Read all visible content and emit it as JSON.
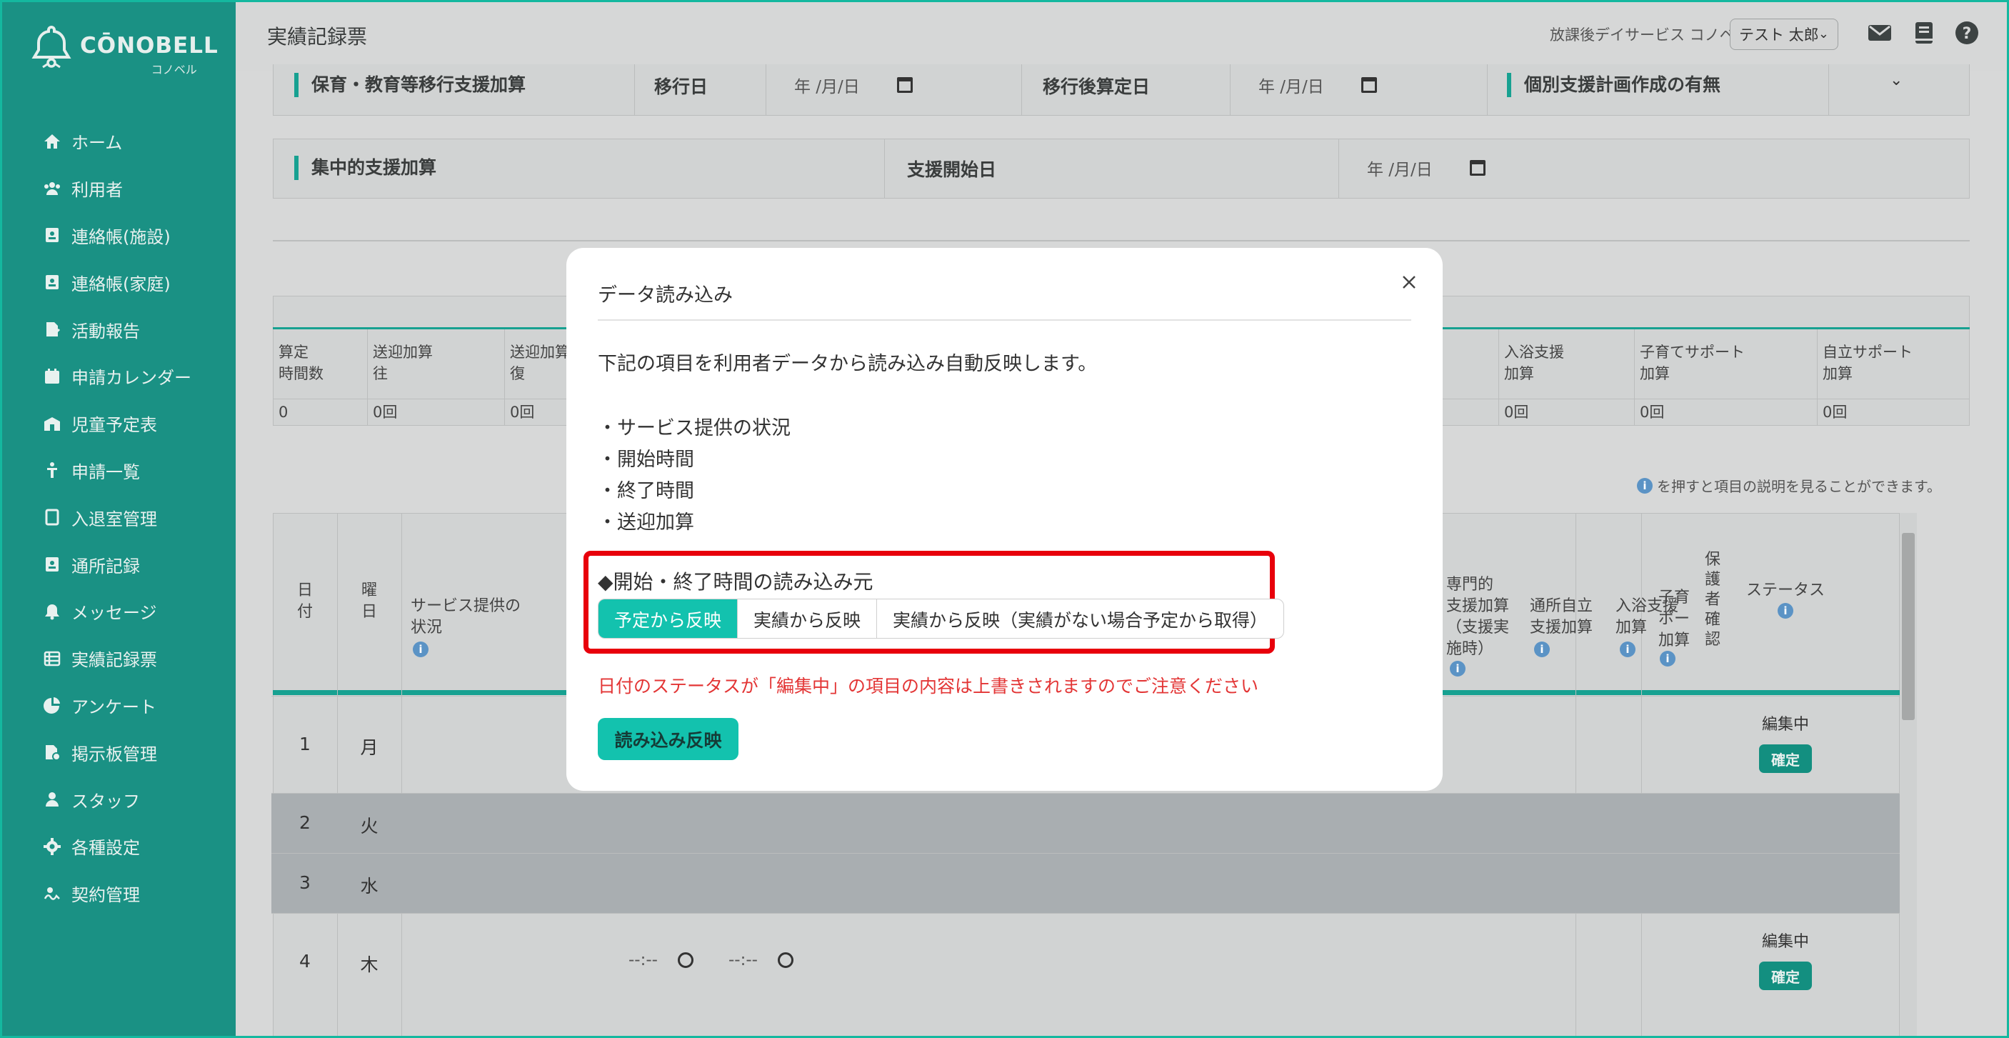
{
  "brand": {
    "name": "CŌNOBELL",
    "sub": "コノベル"
  },
  "sidebar": {
    "items": [
      {
        "label": "ホーム",
        "icon": "home-icon"
      },
      {
        "label": "利用者",
        "icon": "users-icon"
      },
      {
        "label": "連絡帳(施設)",
        "icon": "contact-book-icon"
      },
      {
        "label": "連絡帳(家庭)",
        "icon": "contact-book-icon"
      },
      {
        "label": "活動報告",
        "icon": "report-icon"
      },
      {
        "label": "申請カレンダー",
        "icon": "calendar-icon"
      },
      {
        "label": "児童予定表",
        "icon": "schedule-icon"
      },
      {
        "label": "申請一覧",
        "icon": "person-icon"
      },
      {
        "label": "入退室管理",
        "icon": "door-icon"
      },
      {
        "label": "通所記録",
        "icon": "record-icon"
      },
      {
        "label": "メッセージ",
        "icon": "bell-icon"
      },
      {
        "label": "実績記録票",
        "icon": "table-icon"
      },
      {
        "label": "アンケート",
        "icon": "pie-chart-icon"
      },
      {
        "label": "掲示板管理",
        "icon": "board-icon"
      },
      {
        "label": "スタッフ",
        "icon": "staff-icon"
      },
      {
        "label": "各種設定",
        "icon": "gear-icon"
      },
      {
        "label": "契約管理",
        "icon": "contract-icon"
      }
    ]
  },
  "header": {
    "title": "実績記録票",
    "facility": "放課後デイサービス コノベル",
    "user": "テスト 太郎"
  },
  "background": {
    "transition_label": "保育・教育等移行支援加算",
    "transition_date_label": "移行日",
    "after_calc_label": "移行後算定日",
    "plan_label": "個別支援計画作成の有無",
    "date_placeholder": "年 /月/日",
    "intensive_label": "集中的支援加算",
    "support_start_label": "支援開始日",
    "summary_headers": [
      "算定\n時間数",
      "送迎加算\n往",
      "送迎加算\n復",
      "入浴支援\n加算",
      "子育てサポート\n加算",
      "自立サポート\n加算"
    ],
    "summary_values": [
      "0",
      "0回",
      "0回",
      "0回",
      "0回",
      "0回"
    ],
    "hint": "を押すと項目の説明を見ることができます。",
    "table_headers": {
      "day": "日\n付",
      "weekday": "曜\n日",
      "service_status": "サービス提供の\n状況",
      "specialized": "専門的\n支援加算\n（支援実\n施時）",
      "independence": "通所自立\n支援加算",
      "bath": "入浴支援\n加算",
      "childcare": "子育\nポー\n加算",
      "guardian": "保\n護\n者\n確\n認",
      "status": "ステータス"
    },
    "rows": [
      {
        "day": "1",
        "weekday": "月",
        "status": "編集中",
        "confirm": "確定"
      },
      {
        "day": "2",
        "weekday": "火"
      },
      {
        "day": "3",
        "weekday": "水"
      },
      {
        "day": "4",
        "weekday": "木",
        "start": "--:--",
        "end": "--:--",
        "status": "編集中",
        "confirm": "確定"
      }
    ]
  },
  "modal": {
    "title": "データ読み込み",
    "description": "下記の項目を利用者データから読み込み自動反映します。",
    "items": [
      "・サービス提供の状況",
      "・開始時間",
      "・終了時間",
      "・送迎加算"
    ],
    "source_label": "◆開始・終了時間の読み込み元",
    "options": [
      "予定から反映",
      "実績から反映",
      "実績から反映（実績がない場合予定から取得）"
    ],
    "selected_option": 0,
    "warning": "日付のステータスが「編集中」の項目の内容は上書きされますのでご注意ください",
    "apply_label": "読み込み反映"
  }
}
